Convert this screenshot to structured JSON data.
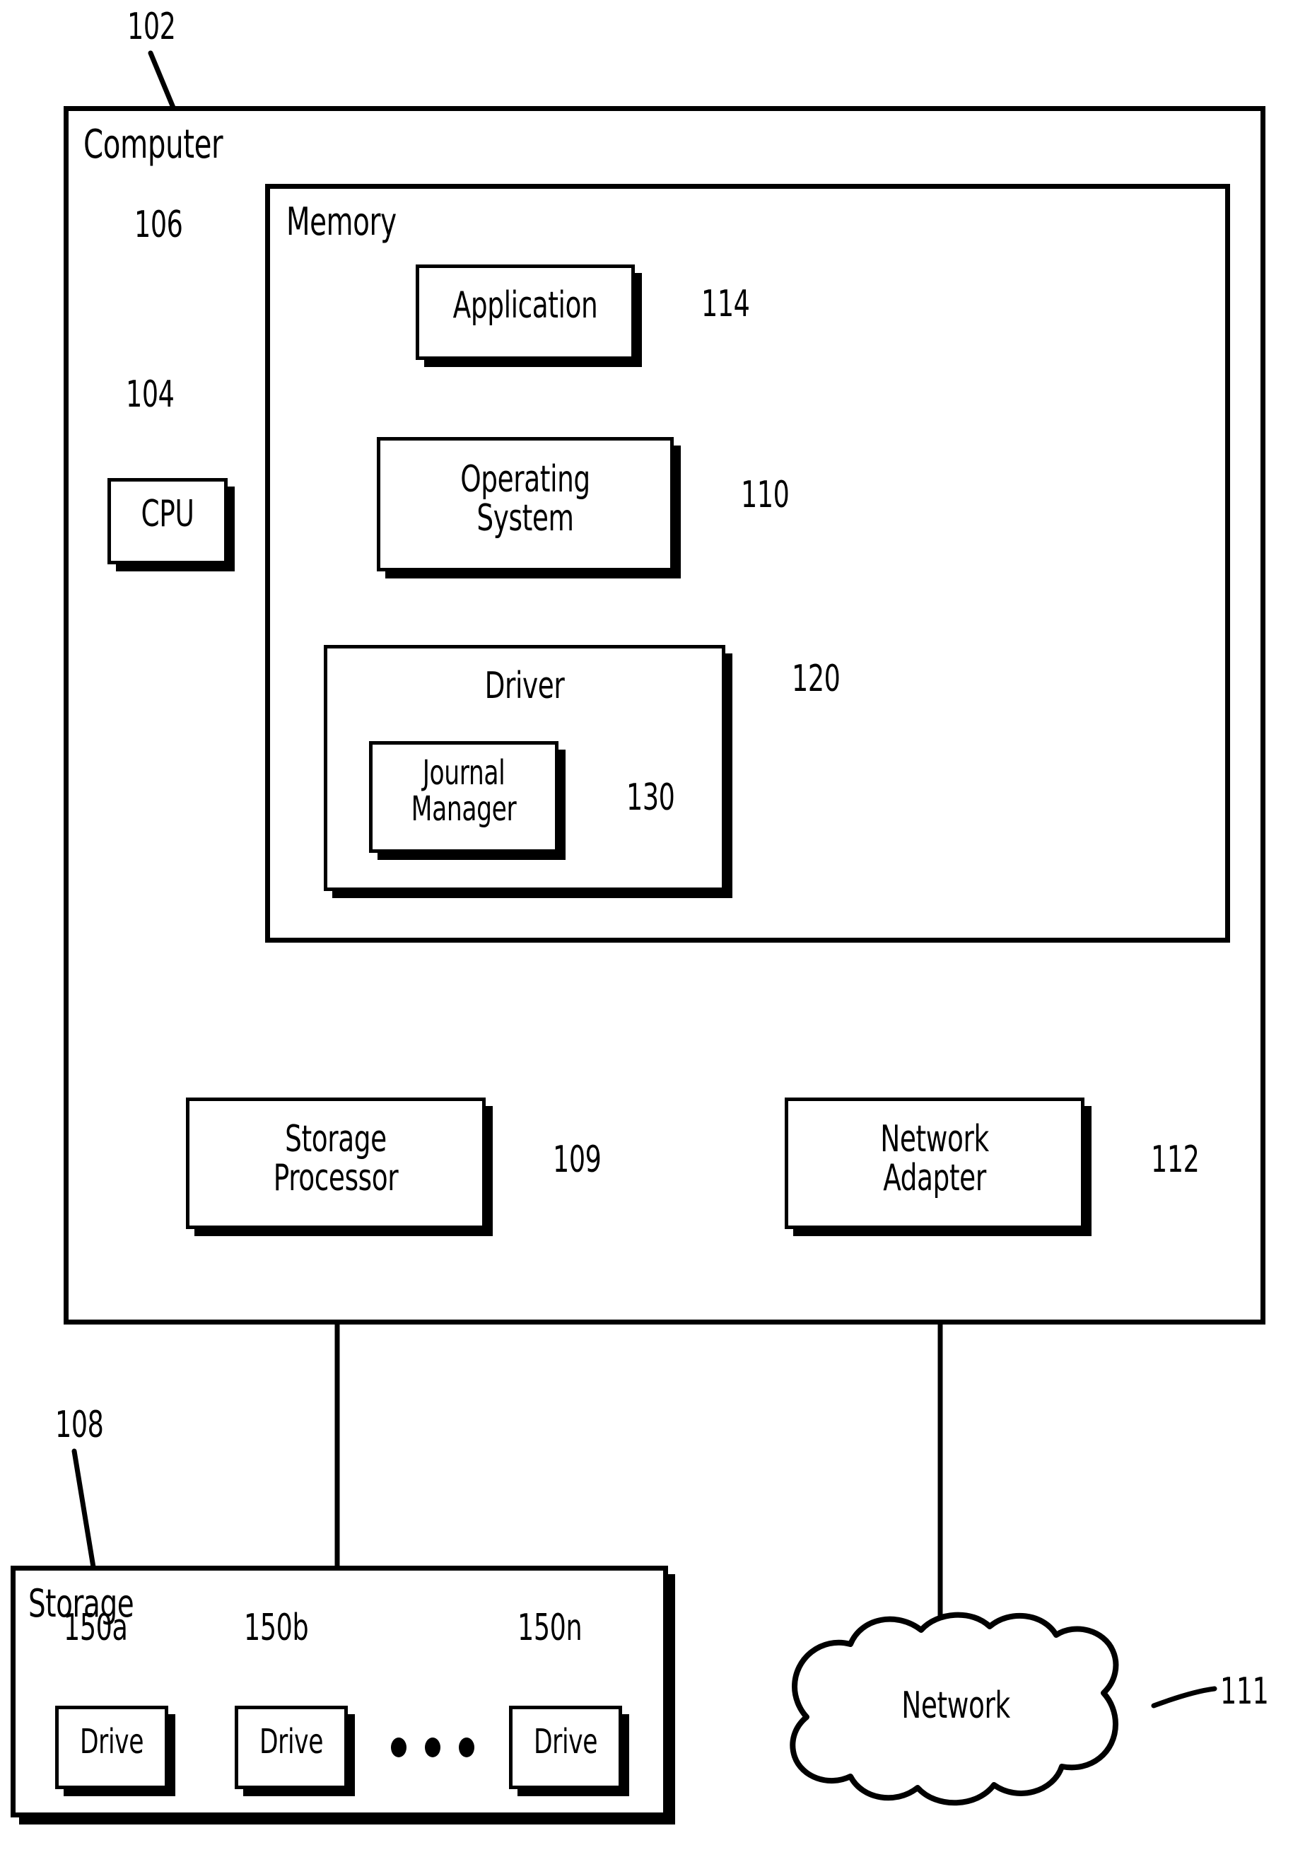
{
  "figure": {
    "type": "patent-block-diagram",
    "background": "#ffffff",
    "stroke_color": "#000000"
  },
  "computer": {
    "title": "Computer",
    "ref": "102"
  },
  "memory": {
    "title": "Memory",
    "ref": "106"
  },
  "cpu": {
    "label": "CPU",
    "ref": "104"
  },
  "application": {
    "label": "Application",
    "ref": "114"
  },
  "operating_system": {
    "label_line1": "Operating",
    "label_line2": "System",
    "ref": "110"
  },
  "driver": {
    "title": "Driver",
    "ref": "120"
  },
  "journal_manager": {
    "label_line1": "Journal",
    "label_line2": "Manager",
    "ref": "130"
  },
  "storage_processor": {
    "label_line1": "Storage",
    "label_line2": "Processor",
    "ref": "109"
  },
  "network_adapter": {
    "label_line1": "Network",
    "label_line2": "Adapter",
    "ref": "112"
  },
  "storage": {
    "title": "Storage",
    "ref": "108",
    "drives": [
      {
        "label": "Drive",
        "ref": "150a"
      },
      {
        "label": "Drive",
        "ref": "150b"
      },
      {
        "label": "Drive",
        "ref": "150n"
      }
    ],
    "ellipsis": "• • •"
  },
  "network": {
    "label": "Network",
    "ref": "111"
  }
}
